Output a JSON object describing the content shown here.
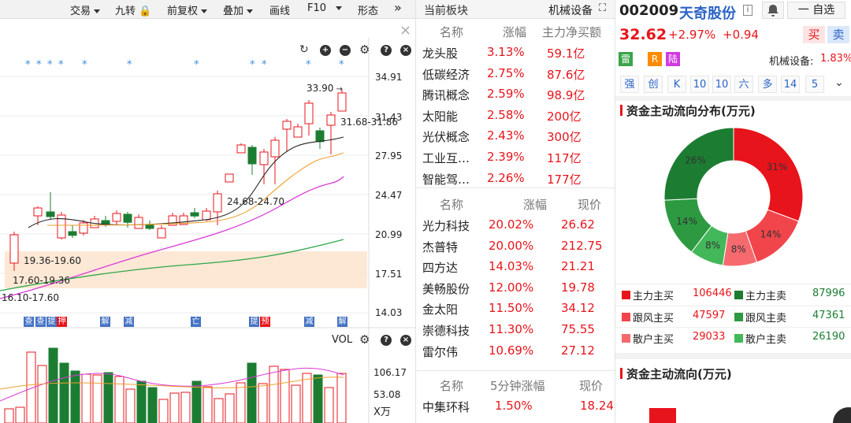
{
  "toolbar": {
    "items": [
      "交易",
      "九转",
      "前复权",
      "叠加",
      "画线",
      "F10",
      "形态"
    ],
    "more": "»",
    "close": "×"
  },
  "price_axis": [
    "34.91",
    "31.43",
    "27.95",
    "24.47",
    "20.99",
    "17.51",
    "14.03"
  ],
  "annotations": {
    "high": "33.90",
    "last_range": "31.68-31.86",
    "mid_range": "24.68-24.70",
    "zone1": "19.36-19.60",
    "zone2": "17.60-19.36",
    "zone3": "16.10-17.60"
  },
  "event_marks": [
    {
      "t": "查",
      "c": "#4472c4"
    },
    {
      "t": "查",
      "c": "#4472c4"
    },
    {
      "t": "提",
      "c": "#4472c4"
    },
    {
      "t": "押",
      "c": "#e8141b"
    },
    {
      "t": "解",
      "c": "#4472c4"
    },
    {
      "t": "减",
      "c": "#4472c4"
    },
    {
      "t": "亡",
      "c": "#4472c4"
    },
    {
      "t": "提",
      "c": "#4472c4"
    },
    {
      "t": "预",
      "c": "#e8141b"
    },
    {
      "t": "减",
      "c": "#4472c4"
    },
    {
      "t": "解",
      "c": "#4472c4"
    }
  ],
  "volume": {
    "title": "VOL",
    "axis": [
      "106.17",
      "53.08",
      "X万"
    ]
  },
  "sector": {
    "header_left": "当前板块",
    "header_right": "机械设备",
    "cols": [
      "名称",
      "涨幅",
      "主力净买额"
    ],
    "rows": [
      {
        "name": "龙头股",
        "chg": "3.13%",
        "amt": "59.1亿"
      },
      {
        "name": "低碳经济",
        "chg": "2.75%",
        "amt": "87.6亿"
      },
      {
        "name": "腾讯概念",
        "chg": "2.59%",
        "amt": "98.9亿"
      },
      {
        "name": "太阳能",
        "chg": "2.58%",
        "amt": "200亿"
      },
      {
        "name": "光伏概念",
        "chg": "2.43%",
        "amt": "300亿"
      },
      {
        "name": "工业互…",
        "chg": "2.39%",
        "amt": "117亿"
      },
      {
        "name": "智能驾…",
        "chg": "2.26%",
        "amt": "177亿"
      }
    ]
  },
  "gainers": {
    "cols": [
      "名称",
      "涨幅",
      "现价"
    ],
    "rows": [
      {
        "name": "光力科技",
        "chg": "20.02%",
        "price": "26.62"
      },
      {
        "name": "杰普特",
        "chg": "20.00%",
        "price": "212.75"
      },
      {
        "name": "四方达",
        "chg": "14.03%",
        "price": "21.21"
      },
      {
        "name": "美畅股份",
        "chg": "12.00%",
        "price": "19.78"
      },
      {
        "name": "金太阳",
        "chg": "11.50%",
        "price": "34.12"
      },
      {
        "name": "崇德科技",
        "chg": "11.30%",
        "price": "75.55"
      },
      {
        "name": "雷尔伟",
        "chg": "10.69%",
        "price": "27.12"
      }
    ]
  },
  "fivemin": {
    "cols": [
      "名称",
      "5分钟涨幅",
      "现价"
    ],
    "rows": [
      {
        "name": "中集环科",
        "chg": "1.50%",
        "price": "18.24"
      }
    ]
  },
  "stock": {
    "code": "002009",
    "name": "天奇股份",
    "info_icon": "i",
    "watch": "一 自选",
    "price": "32.62",
    "pct": "+2.97%",
    "chg": "+0.94",
    "buy": "买",
    "sell": "卖",
    "tags": [
      {
        "t": "雷",
        "c": "#3aa44a"
      },
      {
        "t": "R",
        "c": "#ff8a00"
      },
      {
        "t": "陆",
        "c": "#d13ae0"
      }
    ],
    "industry_label": "机械设备:",
    "industry_pct": "1.83%",
    "quick": [
      "强",
      "创",
      "K",
      "10",
      "10",
      "六",
      "多",
      "14",
      "5"
    ]
  },
  "fund_dist": {
    "title": "资金主动流向分布(万元)",
    "slices": [
      {
        "label": "31%",
        "value": 31,
        "color": "#e8141b"
      },
      {
        "label": "14%",
        "value": 14,
        "color": "#f0454a"
      },
      {
        "label": "8%",
        "value": 8,
        "color": "#f66a6e"
      },
      {
        "label": "8%",
        "value": 8,
        "color": "#43b85a"
      },
      {
        "label": "14%",
        "value": 14,
        "color": "#2d9a41"
      },
      {
        "label": "26%",
        "value": 26,
        "color": "#1c7d32"
      }
    ],
    "legend": [
      {
        "l1": "主力主买",
        "v1": "106446",
        "c1": "#e8141b",
        "l2": "主力主卖",
        "v2": "87996",
        "c2": "#1c7d32"
      },
      {
        "l1": "跟风主买",
        "v1": "47597",
        "c1": "#f0454a",
        "l2": "跟风主卖",
        "v2": "47361",
        "c2": "#2d9a41"
      },
      {
        "l1": "散户主买",
        "v1": "29033",
        "c1": "#f66a6e",
        "l2": "散户主卖",
        "v2": "26190",
        "c2": "#43b85a"
      }
    ]
  },
  "fund_flow": {
    "title": "资金主动流向(万元)"
  },
  "colors": {
    "up": "#e8141b",
    "down": "#1c7d32",
    "accent": "#2a63c6"
  }
}
